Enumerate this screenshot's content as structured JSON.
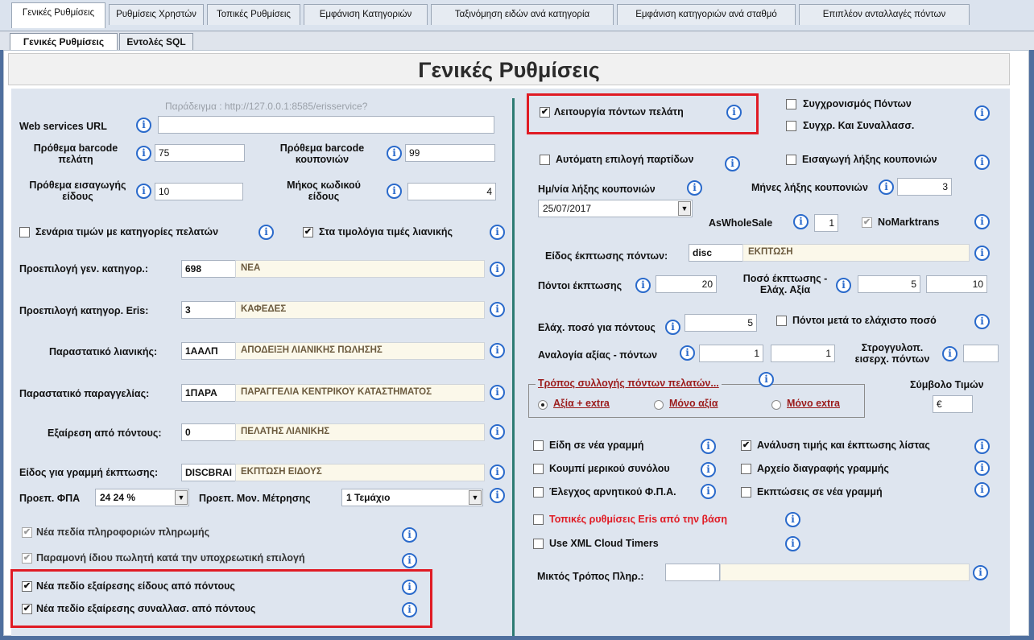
{
  "top_tabs": [
    "Γενικές Ρυθμίσεις",
    "Ρυθμίσεις Χρηστών",
    "Τοπικές Ρυθμίσεις",
    "Εμφάνιση Κατηγοριών",
    "Ταξινόμηση ειδών ανά κατηγορία",
    "Εμφάνιση κατηγοριών ανά σταθμό",
    "Επιπλέον ανταλλαγές πόντων"
  ],
  "sub_tabs": [
    "Γενικές Ρυθμίσεις",
    "Εντολές SQL"
  ],
  "title": "Γενικές Ρυθμίσεις",
  "info_glyph": "i",
  "left": {
    "ws_placeholder": "Παράδειγμα : http://127.0.0.1:8585/erisservice?",
    "ws_label": "Web services URL",
    "ws_value": "",
    "barcode_customer_label": "Πρόθεμα barcode πελάτη",
    "barcode_customer_value": "75",
    "barcode_coupon_label": "Πρόθεμα barcode κουπονιών",
    "barcode_coupon_value": "99",
    "item_prefix_label": "Πρόθεμα εισαγωγής είδους",
    "item_prefix_value": "10",
    "code_length_label": "Μήκος κωδικού είδους",
    "code_length_value": "4",
    "scenario_label": "Σενάρια τιμών με κατηγορίες πελατών",
    "retail_prices_label": "Στα τιμολόγια τιμές λιανικής",
    "rows": [
      {
        "label": "Προεπιλογή γεν. κατηγορ.:",
        "code": "698",
        "desc": "ΝΕΑ"
      },
      {
        "label": "Προεπιλογή κατηγορ. Eris:",
        "code": "3",
        "desc": "ΚΑΦΕΔΕΣ"
      },
      {
        "label": "Παραστατικό λιανικής:",
        "code": "1ΑΑΛΠ",
        "desc": "ΑΠΟΔΕΙΞΗ ΛΙΑΝΙΚΗΣ ΠΩΛΗΣΗΣ"
      },
      {
        "label": "Παραστατικό παραγγελίας:",
        "code": "1ΠΑΡΑ",
        "desc": "ΠΑΡΑΓΓΕΛΙΑ ΚΕΝΤΡΙΚΟΥ ΚΑΤΑΣΤΗΜΑΤΟΣ"
      },
      {
        "label": "Εξαίρεση από πόντους:",
        "code": "0",
        "desc": "ΠΕΛΑΤΗΣ ΛΙΑΝΙΚΗΣ"
      },
      {
        "label": "Είδος για γραμμή έκπτωσης:",
        "code": "DISCBRAI",
        "desc": "ΕΚΠΤΩΣΗ ΕΙΔΟΥΣ"
      }
    ],
    "vat_label": "Προεπ. ΦΠΑ",
    "vat_value": "24  24 %",
    "unit_label": "Προεπ. Μον. Μέτρησης",
    "unit_value": "1  Τεμάχιο",
    "checks": [
      "Νέα πεδία πληροφοριών πληρωμής",
      "Παραμονή ίδιου πωλητή κατά την υποχρεωτική επιλογή",
      "Νέα πεδίο εξαίρεσης είδους από πόντους",
      "Νέα πεδίο εξαίρεσης συναλλασ. από πόντους"
    ]
  },
  "right": {
    "points_label": "Λειτουργία πόντων πελάτη",
    "sync_points_label": "Συγχρονισμός Πόντων",
    "sync_trans_label": "Συγχρ. Και Συναλλασσ.",
    "auto_batch_label": "Αυτόματη επιλογή παρτίδων",
    "coupon_expiry_import_label": "Εισαγωγή λήξης κουπονιών",
    "coupon_expiry_date_label": "Ημ/νία λήξης κουπονιών",
    "coupon_expiry_date_value": "25/07/2017",
    "coupon_months_label": "Μήνες λήξης κουπονιών",
    "coupon_months_value": "3",
    "aswholesale_label": "AsWholeSale",
    "aswholesale_value": "1",
    "nomarktrans_label": "NoMarktrans",
    "disc_item_label": "Είδος έκπτωσης πόντων:",
    "disc_item_code": "disc",
    "disc_item_desc": "ΕΚΠΤΩΣΗ",
    "disc_points_label": "Πόντοι έκπτωσης",
    "disc_points_value": "20",
    "disc_amount_label": "Ποσό έκπτωσης - Ελάχ. Αξία",
    "disc_amount_value1": "5",
    "disc_amount_value2": "10",
    "min_amount_label": "Ελάχ. ποσό για πόντους",
    "min_amount_value": "5",
    "points_after_min_label": "Πόντοι μετά το ελάχιστο ποσό",
    "ratio_label": "Αναλογία αξίας - πόντων",
    "ratio_value1": "1",
    "ratio_value2": "1",
    "round_label": "Στρογγυλοπ. εισερχ. πόντων",
    "round_value": "",
    "collect_group_label": "Τρόπος συλλογής πόντων πελατών...",
    "collect_options": [
      "Αξία + extra",
      "Μόνο αξία",
      "Μόνο extra"
    ],
    "symbol_label": "Σύμβολο Τιμών",
    "symbol_value": "€",
    "opts_left": [
      "Είδη σε νέα γραμμή",
      "Κουμπί μερικού συνόλου",
      "Έλεγχος αρνητικού Φ.Π.Α.",
      "Τοπικές ρυθμίσεις Eris από την βάση",
      "Use XML Cloud Timers"
    ],
    "opts_right": [
      "Ανάλυση τιμής και έκπτωσης λίστας",
      "Αρχείο διαγραφής γραμμής",
      "Εκπτώσεις σε νέα γραμμή"
    ],
    "mixed_label": "Μικτός Τρόπος Πληρ.:",
    "mixed_code": "",
    "mixed_desc": ""
  },
  "check_mark": "✔",
  "dropdown_arrow": "▼",
  "highlight_color": "#e01b24",
  "accent_color": "#2d7b73"
}
